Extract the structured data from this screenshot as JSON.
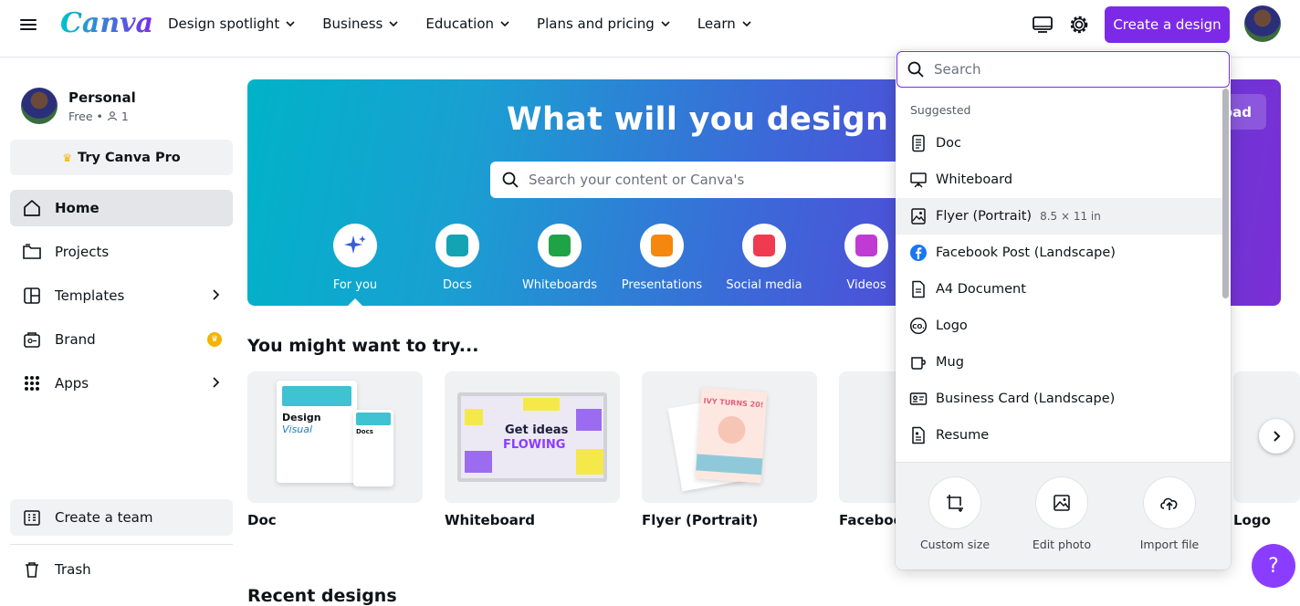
{
  "header": {
    "logo": "Canva",
    "nav": [
      "Design spotlight",
      "Business",
      "Education",
      "Plans and pricing",
      "Learn"
    ],
    "create_label": "Create a design"
  },
  "sidebar": {
    "profile_name": "Personal",
    "profile_plan": "Free •",
    "profile_members": "1",
    "pro_label": "Try Canva Pro",
    "items": [
      {
        "label": "Home"
      },
      {
        "label": "Projects"
      },
      {
        "label": "Templates"
      },
      {
        "label": "Brand"
      },
      {
        "label": "Apps"
      }
    ],
    "team_label": "Create a team",
    "trash_label": "Trash"
  },
  "hero": {
    "title": "What will you design today?",
    "upload_label": "Upload",
    "search_placeholder": "Search your content or Canva's",
    "categories": [
      {
        "label": "For you",
        "color": "#3b5bdb"
      },
      {
        "label": "Docs",
        "color": "#13a3b5"
      },
      {
        "label": "Whiteboards",
        "color": "#1ea446"
      },
      {
        "label": "Presentations",
        "color": "#f5860e"
      },
      {
        "label": "Social media",
        "color": "#ef3a4f"
      },
      {
        "label": "Videos",
        "color": "#c03ad3"
      }
    ]
  },
  "main": {
    "section_title": "You might want to try...",
    "cards": [
      "Doc",
      "Whiteboard",
      "Flyer (Portrait)",
      "Facebook",
      "Logo"
    ],
    "card_art": {
      "doc_title_1": "Design",
      "doc_title_2": "Visual",
      "doc_title_3": "Docs",
      "whiteboard_text_1": "Get ideas",
      "whiteboard_text_2": "FLOWING",
      "flyer_text": "IVY TURNS 20!"
    },
    "recent_title": "Recent designs",
    "help_label": "?"
  },
  "dropdown": {
    "search_placeholder": "Search",
    "section": "Suggested",
    "items": [
      {
        "label": "Doc",
        "icon": "doc-icon",
        "dims": ""
      },
      {
        "label": "Whiteboard",
        "icon": "whiteboard-icon",
        "dims": ""
      },
      {
        "label": "Flyer (Portrait)",
        "icon": "image-icon",
        "dims": "8.5 × 11 in"
      },
      {
        "label": "Facebook Post (Landscape)",
        "icon": "facebook-icon",
        "dims": ""
      },
      {
        "label": "A4 Document",
        "icon": "document-icon",
        "dims": ""
      },
      {
        "label": "Logo",
        "icon": "logo-icon",
        "dims": ""
      },
      {
        "label": "Mug",
        "icon": "mug-icon",
        "dims": ""
      },
      {
        "label": "Business Card (Landscape)",
        "icon": "business-card-icon",
        "dims": ""
      },
      {
        "label": "Resume",
        "icon": "resume-icon",
        "dims": ""
      }
    ],
    "actions": [
      "Custom size",
      "Edit photo",
      "Import file"
    ]
  },
  "colors": {
    "accent": "#7d2ae8",
    "help": "#8b3dff"
  }
}
